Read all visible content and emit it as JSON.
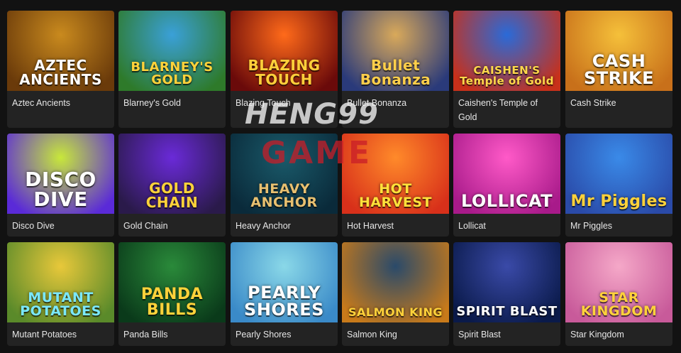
{
  "games": [
    {
      "name": "Aztec Ancients",
      "logo": "AZTEC ANCIENTS",
      "logo_color": "#ffffff",
      "bg": [
        "#c98a1e",
        "#6a3a0a"
      ]
    },
    {
      "name": "Blarney's Gold",
      "logo": "BLARNEY'S GOLD",
      "logo_color": "#ffd23a",
      "bg": [
        "#3aa0d8",
        "#2e7a2a"
      ]
    },
    {
      "name": "Blazing Touch",
      "logo": "BLAZING TOUCH",
      "logo_color": "#ffcf3a",
      "bg": [
        "#ff6a1a",
        "#6a0a0a"
      ]
    },
    {
      "name": "Bullet Bonanza",
      "logo": "Bullet Bonanza",
      "logo_color": "#ffcf4a",
      "bg": [
        "#d9a95a",
        "#2a3a7a"
      ]
    },
    {
      "name": "Caishen's Temple of Gold",
      "logo": "CAISHEN'S Temple of Gold",
      "logo_color": "#ffd84a",
      "bg": [
        "#2a6ad8",
        "#c8301a"
      ]
    },
    {
      "name": "Cash Strike",
      "logo": "CASH STRIKE",
      "logo_color": "#ffffff",
      "bg": [
        "#f5c03a",
        "#c8701a"
      ]
    },
    {
      "name": "Disco Dive",
      "logo": "DISCO DIVE",
      "logo_color": "#ffffff",
      "bg": [
        "#c8e83a",
        "#5a2ad8"
      ]
    },
    {
      "name": "Gold Chain",
      "logo": "GOLD CHAIN",
      "logo_color": "#ffd23a",
      "bg": [
        "#6a2ad8",
        "#2a1a4a"
      ]
    },
    {
      "name": "Heavy Anchor",
      "logo": "HEAVY ANCHOR",
      "logo_color": "#e8c070",
      "bg": [
        "#1a5a6a",
        "#0a2a3a"
      ]
    },
    {
      "name": "Hot Harvest",
      "logo": "HOT HARVEST",
      "logo_color": "#ffe23a",
      "bg": [
        "#ff8a2a",
        "#d8301a"
      ]
    },
    {
      "name": "Lollicat",
      "logo": "LOLLICAT",
      "logo_color": "#ffffff",
      "bg": [
        "#ff5ac8",
        "#a81a8a"
      ]
    },
    {
      "name": "Mr Piggles",
      "logo": "Mr Piggles",
      "logo_color": "#ffd23a",
      "bg": [
        "#3a8ae8",
        "#2a4aa8"
      ]
    },
    {
      "name": "Mutant Potatoes",
      "logo": "MUTANT POTATOES",
      "logo_color": "#7ae8ff",
      "bg": [
        "#e8c83a",
        "#5a8a2a"
      ]
    },
    {
      "name": "Panda Bills",
      "logo": "PANDA BILLS",
      "logo_color": "#ffd23a",
      "bg": [
        "#2a8a3a",
        "#0a3a1a"
      ]
    },
    {
      "name": "Pearly Shores",
      "logo": "PEARLY SHORES",
      "logo_color": "#ffffff",
      "bg": [
        "#8ad8e8",
        "#3a8ac8"
      ]
    },
    {
      "name": "Salmon King",
      "logo": "SALMON KING",
      "logo_color": "#ffd23a",
      "bg": [
        "#2a4a6a",
        "#c87a1a"
      ]
    },
    {
      "name": "Spirit Blast",
      "logo": "SPIRIT BLAST",
      "logo_color": "#ffffff",
      "bg": [
        "#3a4aa8",
        "#0a1a4a"
      ]
    },
    {
      "name": "Star Kingdom",
      "logo": "STAR KINGDOM",
      "logo_color": "#ffd23a",
      "bg": [
        "#f5a8c8",
        "#c85a9a"
      ]
    }
  ],
  "watermark": {
    "line1": "HENG99",
    "line2": "GAME"
  }
}
